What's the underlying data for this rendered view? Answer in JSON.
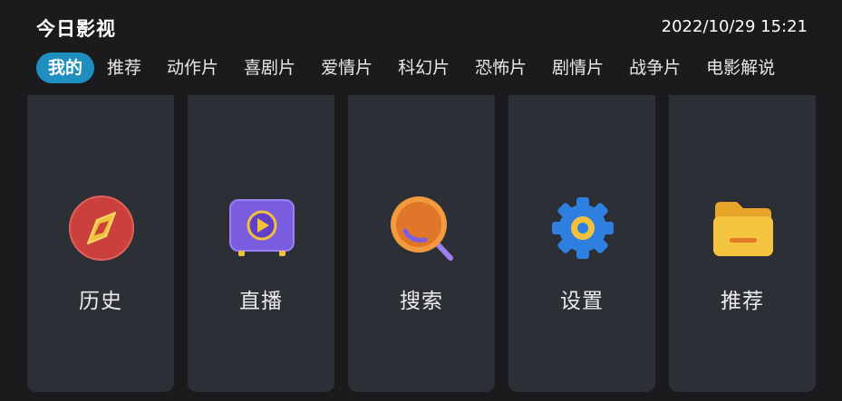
{
  "header": {
    "title": "今日影视",
    "datetime": "2022/10/29 15:21"
  },
  "tabs": [
    {
      "label": "我的",
      "active": true
    },
    {
      "label": "推荐"
    },
    {
      "label": "动作片"
    },
    {
      "label": "喜剧片"
    },
    {
      "label": "爱情片"
    },
    {
      "label": "科幻片"
    },
    {
      "label": "恐怖片"
    },
    {
      "label": "剧情片"
    },
    {
      "label": "战争片"
    },
    {
      "label": "电影解说"
    }
  ],
  "cards": [
    {
      "label": "历史",
      "icon": "compass-icon"
    },
    {
      "label": "直播",
      "icon": "tv-play-icon"
    },
    {
      "label": "搜索",
      "icon": "search-icon"
    },
    {
      "label": "设置",
      "icon": "gear-icon"
    },
    {
      "label": "推荐",
      "icon": "folder-icon"
    }
  ],
  "colors": {
    "background": "#1b1b1d",
    "card": "#2d2f36",
    "accent": "#1f8fbf"
  }
}
